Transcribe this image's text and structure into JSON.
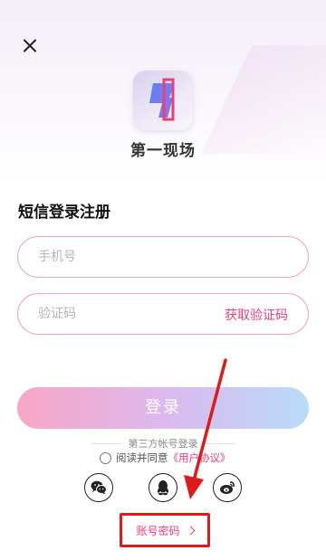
{
  "app": {
    "name": "第一现场"
  },
  "page": {
    "title": "短信登录注册"
  },
  "form": {
    "phone_placeholder": "手机号",
    "code_placeholder": "验证码",
    "get_code_label": "获取验证码",
    "login_label": "登录"
  },
  "third_party": {
    "label": "第三方帐号登录",
    "providers": [
      {
        "name": "wechat",
        "icon": "wechat-icon"
      },
      {
        "name": "qq",
        "icon": "qq-icon"
      },
      {
        "name": "weibo",
        "icon": "weibo-icon"
      }
    ]
  },
  "agreement": {
    "prefix": "阅读并同意",
    "link": "《用户协议》"
  },
  "account_login": {
    "label": "账号密码"
  },
  "colors": {
    "accent": "#e8407d",
    "field_border": "#f3a3bd",
    "annotation": "#e01a1a",
    "login_gradient": [
      "#f8a7c6",
      "#dcb8ee",
      "#b9dcf7"
    ]
  }
}
